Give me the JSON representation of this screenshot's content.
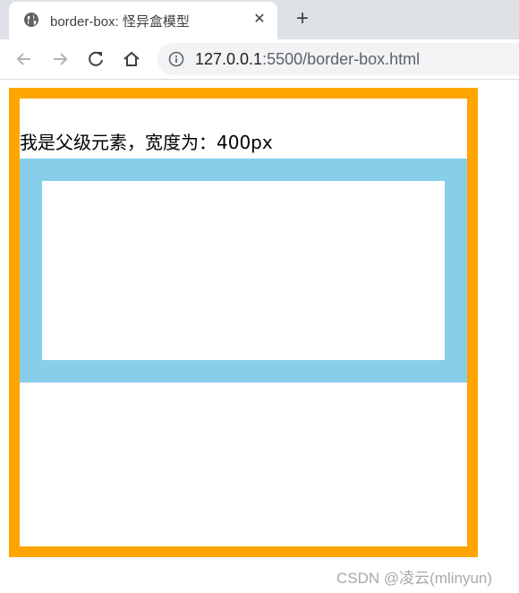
{
  "browser": {
    "tab": {
      "title": "border-box: 怪异盒模型",
      "favicon_icon": "globe-icon",
      "close_icon": "close-icon",
      "close_label": "✕"
    },
    "new_tab_label": "+",
    "toolbar": {
      "back_icon": "arrow-left-icon",
      "forward_icon": "arrow-right-icon",
      "reload_icon": "reload-icon",
      "home_icon": "home-icon",
      "info_icon": "info-icon",
      "url_host": "127.0.0.1",
      "url_rest": ":5500/border-box.html"
    }
  },
  "page": {
    "parent_text": "我是父级元素，宽度为：400px",
    "parent_border_color": "#ffa500",
    "child_border_color": "#87ceeb"
  },
  "watermark": "CSDN @凌云(mlinyun)"
}
